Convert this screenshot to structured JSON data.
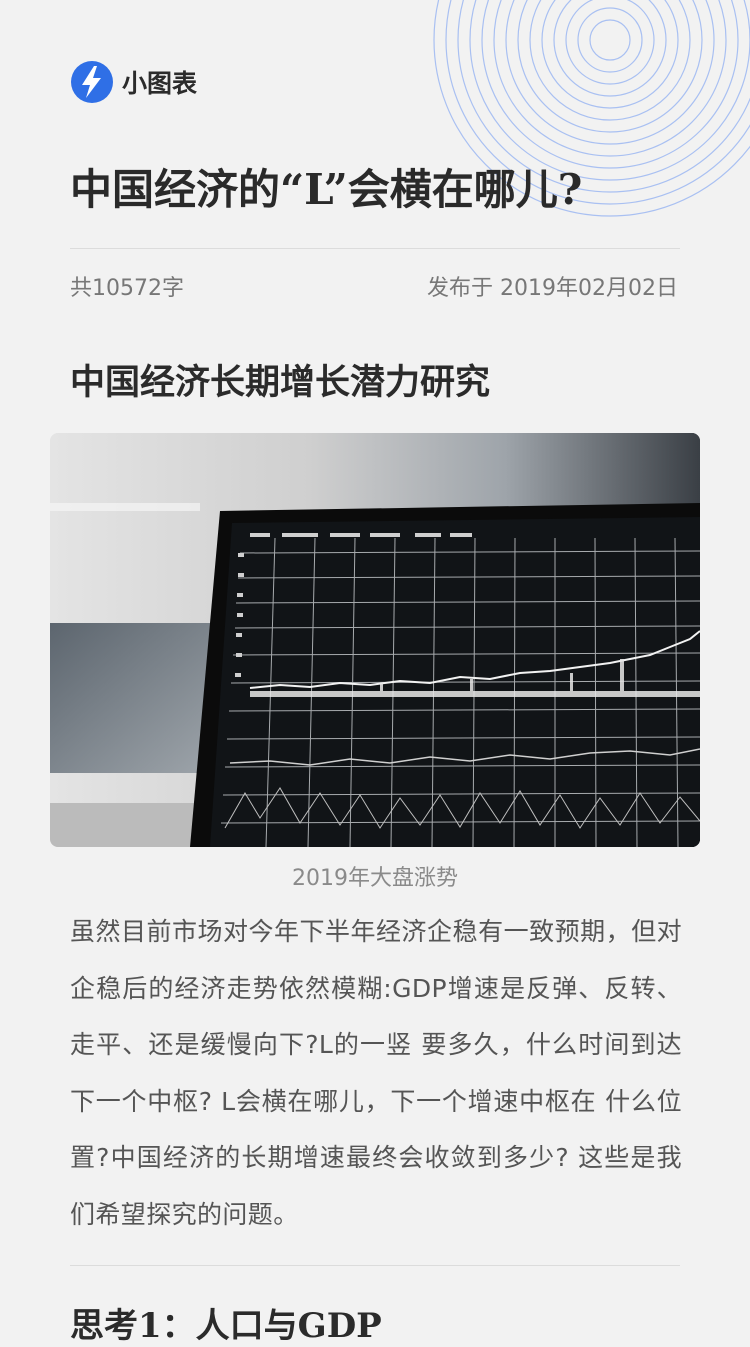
{
  "brand": {
    "name": "小图表",
    "logo_icon": "lightning-bolt-icon",
    "accent": "#2f6fe6"
  },
  "article": {
    "title": "中国经济的“L”会横在哪儿?",
    "word_count": "共10572字",
    "published": "发布于 2019年02月02日",
    "subtitle": "中国经济长期增长潜力研究",
    "image_caption": "2019年大盘涨势",
    "paragraph": "虽然目前市场对今年下半年经济企稳有一致预期，但对企稳后的经济走势依然模糊:GDP增速是反弹、反转、走平、还是缓慢向下?L的一竖 要多久，什么时间到达下一个中枢? L会横在哪儿，下一个增速中枢在 什么位置?中国经济的长期增速最终会收敛到多少? 这些是我们希望探究的问题。",
    "section_heading": "思考1：人口与GDP"
  }
}
